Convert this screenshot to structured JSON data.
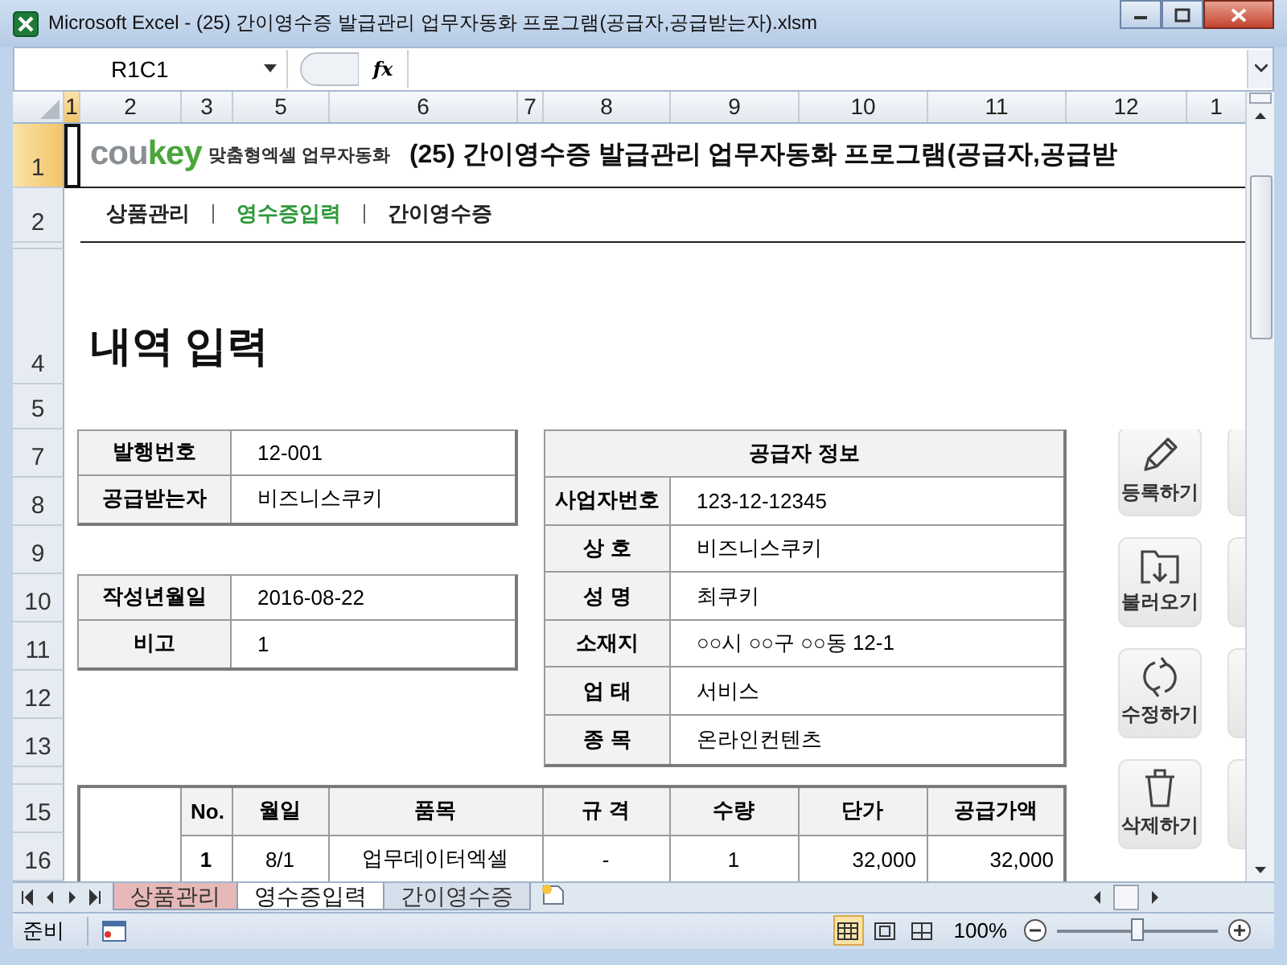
{
  "window": {
    "title": "Microsoft Excel - (25) 간이영수증 발급관리 업무자동화 프로그램(공급자,공급받는자).xlsm"
  },
  "formula_bar": {
    "name_box": "R1C1",
    "function_label": "fx"
  },
  "column_headers": [
    {
      "label": "1",
      "selected": true
    },
    {
      "label": "2",
      "selected": false
    },
    {
      "label": "3",
      "selected": false
    },
    {
      "label": "5",
      "selected": false
    },
    {
      "label": "6",
      "selected": false
    },
    {
      "label": "7",
      "selected": false
    },
    {
      "label": "8",
      "selected": false
    },
    {
      "label": "9",
      "selected": false
    },
    {
      "label": "10",
      "selected": false
    },
    {
      "label": "11",
      "selected": false
    },
    {
      "label": "12",
      "selected": false
    },
    {
      "label": "1",
      "selected": false
    }
  ],
  "row_headers": [
    {
      "label": "1",
      "selected": true
    },
    {
      "label": "2",
      "selected": false
    },
    {
      "label": "4",
      "selected": false
    },
    {
      "label": "5",
      "selected": false
    },
    {
      "label": "7",
      "selected": false
    },
    {
      "label": "8",
      "selected": false
    },
    {
      "label": "9",
      "selected": false
    },
    {
      "label": "10",
      "selected": false
    },
    {
      "label": "11",
      "selected": false
    },
    {
      "label": "12",
      "selected": false
    },
    {
      "label": "13",
      "selected": false
    },
    {
      "label": "15",
      "selected": false
    },
    {
      "label": "16",
      "selected": false
    }
  ],
  "sheet": {
    "logo": {
      "brand_light": "cou",
      "brand_accent": "key",
      "tagline": "맞춤형엑셀 업무자동화"
    },
    "title": "(25) 간이영수증 발급관리 업무자동화 프로그램(공급자,공급받",
    "nav": [
      {
        "label": "상품관리",
        "selected": false
      },
      {
        "label": "영수증입력",
        "selected": true
      },
      {
        "label": "간이영수증",
        "selected": false
      }
    ],
    "heading": "내역 입력",
    "issue_fields": [
      {
        "label": "발행번호",
        "value": "12-001"
      },
      {
        "label": "공급받는자",
        "value": "비즈니스쿠키"
      }
    ],
    "date_fields": [
      {
        "label": "작성년월일",
        "value": "2016-08-22"
      },
      {
        "label": "비고",
        "value": "1"
      }
    ],
    "supplier": {
      "title": "공급자 정보",
      "fields": [
        {
          "label": "사업자번호",
          "value": "123-12-12345"
        },
        {
          "label": "상 호",
          "value": "비즈니스쿠키"
        },
        {
          "label": "성 명",
          "value": "최쿠키"
        },
        {
          "label": "소재지",
          "value": "○○시 ○○구 ○○동 12-1"
        },
        {
          "label": "업 태",
          "value": "서비스"
        },
        {
          "label": "종 목",
          "value": "온라인컨텐츠"
        }
      ]
    },
    "actions": [
      {
        "kind": "pencil",
        "label": "등록하기"
      },
      {
        "kind": "folder",
        "label": "불러오기"
      },
      {
        "kind": "refresh",
        "label": "수정하기"
      },
      {
        "kind": "trash",
        "label": "삭제하기"
      }
    ],
    "items": {
      "columns": [
        "No.",
        "월일",
        "품목",
        "규 격",
        "수량",
        "단가",
        "공급가액"
      ],
      "rows": [
        [
          "1",
          "8/1",
          "업무데이터엑셀",
          "-",
          "1",
          "32,000",
          "32,000"
        ]
      ]
    }
  },
  "sheet_tabs": [
    {
      "label": "상품관리",
      "selected": false,
      "color": "#e6b8b7"
    },
    {
      "label": "영수증입력",
      "selected": true
    },
    {
      "label": "간이영수증",
      "selected": false
    }
  ],
  "status_bar": {
    "mode": "준비",
    "views": [
      {
        "kind": "normal",
        "selected": true
      },
      {
        "kind": "page_layout",
        "selected": false
      },
      {
        "kind": "page_break",
        "selected": false
      }
    ],
    "zoom": "100%",
    "zoom_slider": {
      "level": 0.5
    }
  }
}
